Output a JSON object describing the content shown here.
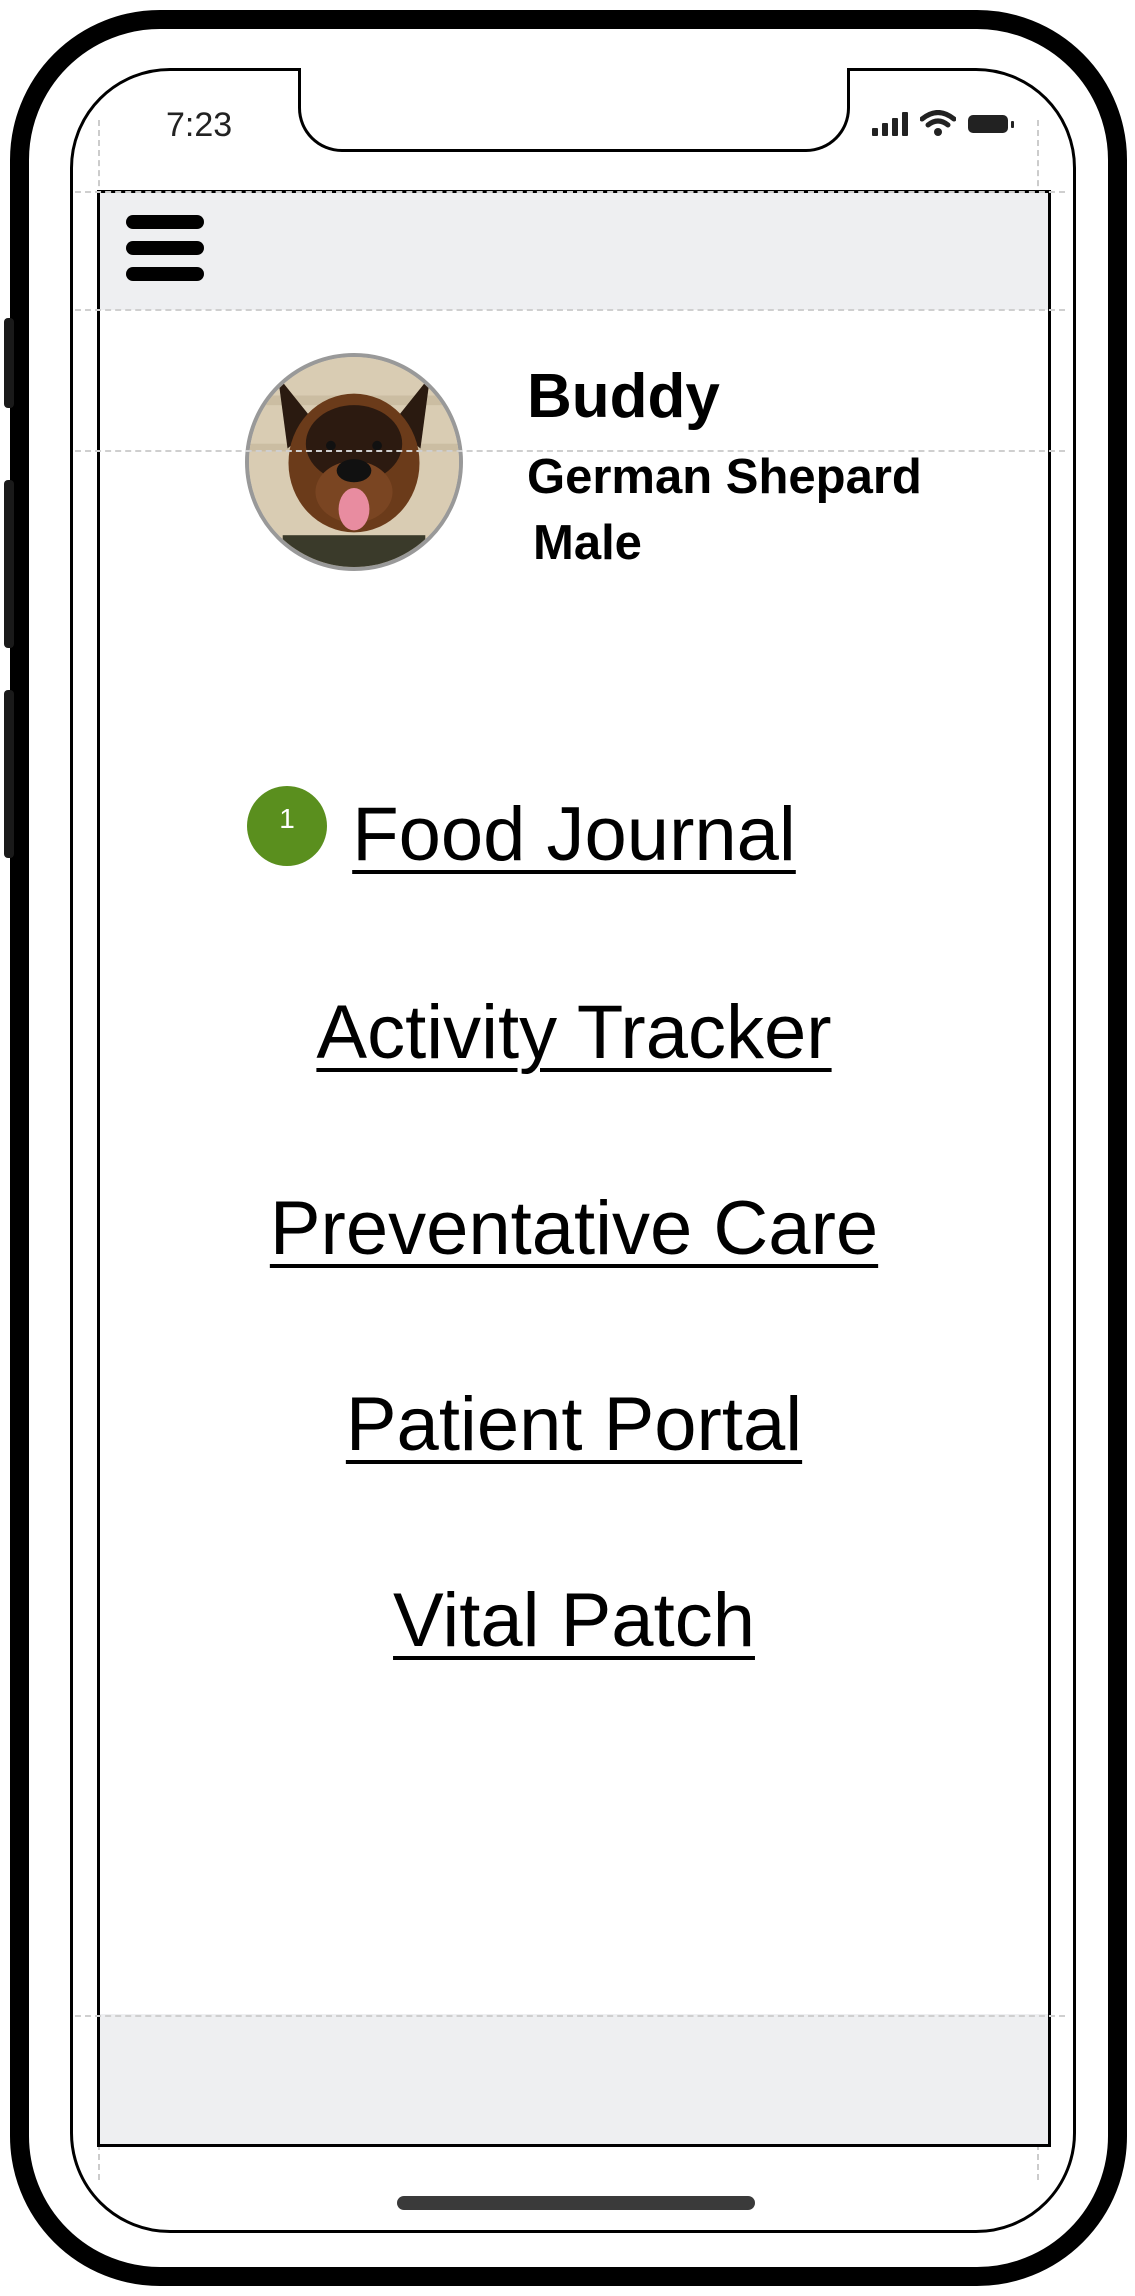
{
  "status_bar": {
    "time": "7:23"
  },
  "pet": {
    "name": "Buddy",
    "breed": "German Shepard",
    "sex": "Male"
  },
  "nav": {
    "badge_count": "1",
    "links": [
      {
        "label": "Food Journal"
      },
      {
        "label": "Activity Tracker"
      },
      {
        "label": "Preventative Care"
      },
      {
        "label": "Patient Portal"
      },
      {
        "label": "Vital Patch"
      }
    ]
  },
  "colors": {
    "badge": "#5a8f1e",
    "bars": "#eeeff1",
    "frame": "#000000"
  },
  "icons": [
    "menu-icon",
    "signal-icon",
    "wifi-icon",
    "battery-icon"
  ]
}
